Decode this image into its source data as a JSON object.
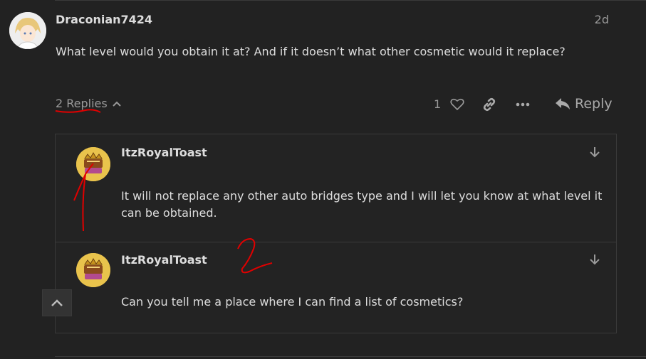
{
  "post": {
    "username": "Draconian7424",
    "date": "2d",
    "text": "What level would you obtain it at? And if it doesn’t what other cosmetic would it replace?",
    "avatar_icon": "anime-avatar-icon"
  },
  "controls": {
    "replies_label": "2 Replies",
    "like_count": "1",
    "reply_label": "Reply"
  },
  "replies": [
    {
      "username": "ItzRoyalToast",
      "text": "It will not replace any other auto bridges type and I will let you know at what level it can be obtained."
    },
    {
      "username": "ItzRoyalToast",
      "text": "Can you tell me a place where I can find a list of cosmetics?"
    }
  ],
  "annotations": {
    "mark_1": "1",
    "mark_2": "2",
    "color": "#e00000"
  },
  "colors": {
    "background": "#222222",
    "text": "#dddddd",
    "muted": "#9a9a9a",
    "border": "#3a3a3a"
  }
}
